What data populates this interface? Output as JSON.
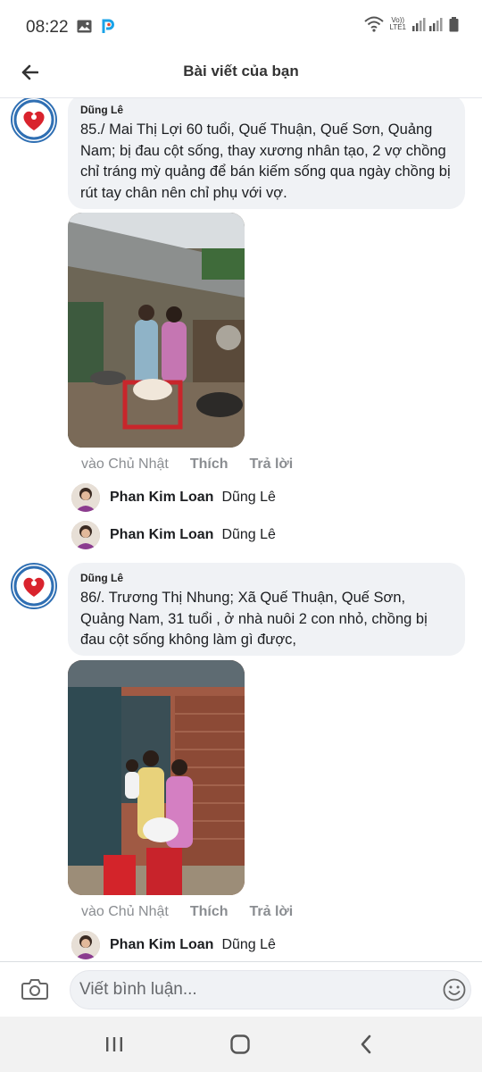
{
  "status_bar": {
    "time": "08:22",
    "network_top": "Vo))",
    "network_bottom": "LTE1",
    "icons": [
      "image-icon",
      "app-p-icon",
      "wifi-icon",
      "signal-icon",
      "battery-icon"
    ]
  },
  "header": {
    "title": "Bài viết của bạn",
    "back_icon": "arrow-left-icon"
  },
  "posts": [
    {
      "author": "Dũng Lê",
      "text": "85./ Mai Thị Lợi 60 tuổi, Quế Thuận, Quế Sơn, Quảng Nam; bị đau cột sống, thay xương nhân tạo, 2 vợ chồng chỉ tráng mỳ quảng để bán kiếm sống qua ngày chồng bị rút tay chân nên chỉ phụ với vợ.",
      "time": "vào Chủ Nhật",
      "like": "Thích",
      "reply": "Trả lời",
      "replies": [
        {
          "name": "Phan Kim Loan",
          "tag": "Dũng Lê"
        },
        {
          "name": "Phan Kim Loan",
          "tag": "Dũng Lê"
        }
      ]
    },
    {
      "author": "Dũng Lê",
      "text": "86/. Trương Thị Nhung; Xã Quế Thuận, Quế Sơn, Quảng Nam, 31 tuổi , ở nhà nuôi 2 con nhỏ, chồng bị đau cột sống không làm gì được,",
      "time": "vào Chủ Nhật",
      "like": "Thích",
      "reply": "Trả lời",
      "replies": [
        {
          "name": "Phan Kim Loan",
          "tag": "Dũng Lê"
        }
      ]
    }
  ],
  "composer": {
    "placeholder": "Viết bình luận...",
    "camera_icon": "camera-icon",
    "emoji_icon": "emoji-icon"
  },
  "nav": {
    "icons": [
      "recent-apps-icon",
      "home-icon",
      "back-icon"
    ]
  }
}
